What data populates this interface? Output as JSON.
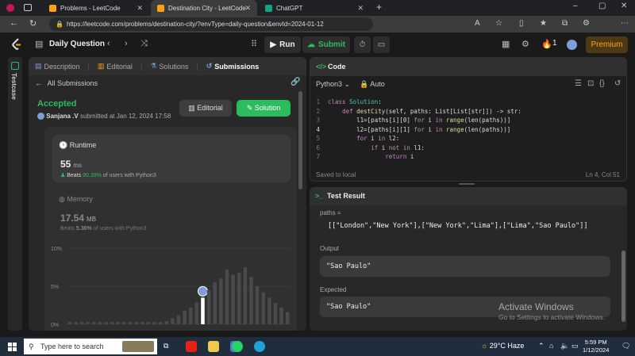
{
  "browser": {
    "tabs": [
      {
        "label": "Problems - LeetCode"
      },
      {
        "label": "Destination City - LeetCode"
      },
      {
        "label": "ChatGPT"
      }
    ],
    "new_tab": "+",
    "url": "https://leetcode.com/problems/destination-city/?envType=daily-question&envId=2024-01-12",
    "window_controls": {
      "minimize": "–",
      "maximize": "▢",
      "close": "✕"
    }
  },
  "header": {
    "daily_label": "Daily Question",
    "run_label": "Run",
    "submit_label": "Submit",
    "streak_count": "1",
    "premium_label": "Premium"
  },
  "rail": {
    "label": "Testcase"
  },
  "left_panel": {
    "tabs": [
      {
        "label": "Description"
      },
      {
        "label": "Editorial"
      },
      {
        "label": "Solutions"
      },
      {
        "label": "Submissions"
      }
    ],
    "back_label": "All Submissions",
    "status": "Accepted",
    "author": "Sanjana .V",
    "submitted_text": "submitted at Jan 12, 2024 17:58",
    "editorial_button": "Editorial",
    "solution_button": "Solution",
    "runtime": {
      "label": "Runtime",
      "value": "55",
      "unit": "ms",
      "beats_prefix": "Beats",
      "beats_pct": "90.39%",
      "beats_suffix": "of users with Python3"
    },
    "memory": {
      "label": "Memory",
      "value": "17.54",
      "unit": "MB",
      "beats_prefix": "Beats",
      "beats_pct": "5.36%",
      "beats_suffix": "of users with Python3"
    }
  },
  "chart_data": {
    "type": "bar",
    "ytick_labels": [
      "10%",
      "5%",
      "0%"
    ],
    "ylim": [
      0,
      10
    ],
    "values": [
      0.3,
      0.3,
      0.3,
      0.3,
      0.3,
      0.3,
      0.3,
      0.3,
      0.3,
      0.3,
      0.3,
      0.3,
      0.3,
      0.3,
      0.3,
      0.3,
      0.4,
      0.8,
      1.2,
      1.8,
      2.2,
      2.9,
      3.5,
      4.5,
      5.5,
      6.0,
      7.2,
      6.5,
      6.8,
      7.5,
      6.2,
      5.0,
      4.2,
      3.5,
      2.8,
      2.2,
      1.6
    ],
    "highlighted_index": 22,
    "bar_color": "#4a4a4a",
    "highlight_color": "#ffffff"
  },
  "code_panel": {
    "title": "Code",
    "language": "Python3",
    "mode": "Auto",
    "lines": [
      {
        "n": "1",
        "html": "<span class='kw'>class</span> <span class='ty'>Solution</span><span class='tx'>:</span>"
      },
      {
        "n": "2",
        "html": "    <span class='kw'>def</span> <span class='fn'>destCity</span><span class='tx'>(self, paths: List[List[str]]) -&gt; str:</span>"
      },
      {
        "n": "3",
        "html": "        <span class='tx'>l1=[paths[i][0] </span><span class='kw'>for</span><span class='tx'> i </span><span class='kw'>in</span> <span class='fn'>range</span><span class='tx'>(len(paths))]</span>"
      },
      {
        "n": "4",
        "html": "        <span class='tx'>l2=[paths[i][1] </span><span class='kw'>for</span><span class='tx'> i </span><span class='kw'>in</span> <span class='fn'>range</span><span class='tx'>(len(paths))]</span>"
      },
      {
        "n": "5",
        "html": "        <span class='kw'>for</span><span class='tx'> i </span><span class='kw'>in</span><span class='tx'> l2:</span>"
      },
      {
        "n": "6",
        "html": "            <span class='kw'>if</span><span class='tx'> i </span><span class='kw'>not in</span><span class='tx'> l1:</span>"
      },
      {
        "n": "7",
        "html": "                <span class='kw'>return</span><span class='tx'> i</span>"
      }
    ],
    "saved_text": "Saved to local",
    "cursor_pos": "Ln 4, Col 51"
  },
  "result_panel": {
    "title": "Test Result",
    "paths_label": "paths =",
    "paths_value": "[[\"London\",\"New York\"],[\"New York\",\"Lima\"],[\"Lima\",\"Sao Paulo\"]]",
    "output_label": "Output",
    "output_value": "\"Sao Paulo\"",
    "expected_label": "Expected",
    "expected_value": "\"Sao Paulo\""
  },
  "watermark": {
    "line1": "Activate Windows",
    "line2": "Go to Settings to activate Windows."
  },
  "taskbar": {
    "search_placeholder": "Type here to search",
    "weather": "29°C  Haze",
    "time": "5:59 PM",
    "date": "1/12/2024"
  }
}
